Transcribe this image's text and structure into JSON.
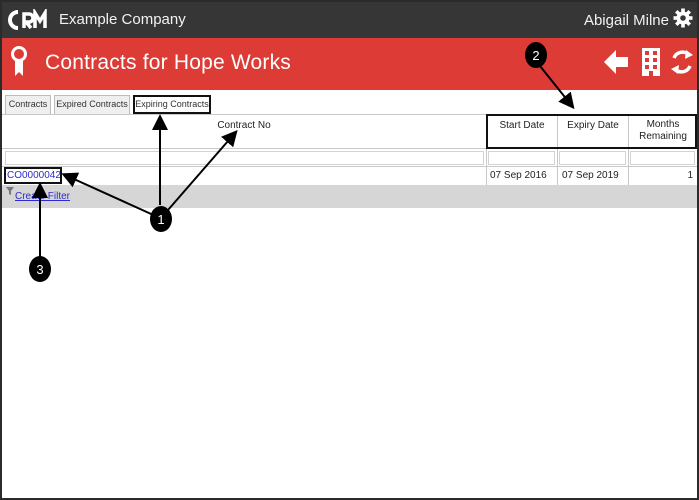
{
  "topbar": {
    "logo_text": "CRM",
    "company": "Example Company",
    "user": "Abigail Milne"
  },
  "header": {
    "title": "Contracts for Hope Works"
  },
  "tabs": [
    {
      "label": "Contracts"
    },
    {
      "label": "Expired Contracts"
    },
    {
      "label": "Expiring Contracts"
    }
  ],
  "table": {
    "columns": {
      "contract_no": "Contract No",
      "start_date": "Start Date",
      "expiry_date": "Expiry Date",
      "months_remaining_1": "Months",
      "months_remaining_2": "Remaining"
    },
    "rows": [
      {
        "contract_no": "CO0000042",
        "start_date": "07 Sep 2016",
        "expiry_date": "07 Sep 2019",
        "months_remaining": "1"
      }
    ],
    "create_filter": "Create Filter"
  },
  "annotations": {
    "badge1": "1",
    "badge2": "2",
    "badge3": "3"
  },
  "colors": {
    "topbar": "#363636",
    "header": "#dd3b35",
    "link": "#2c2ccf"
  }
}
